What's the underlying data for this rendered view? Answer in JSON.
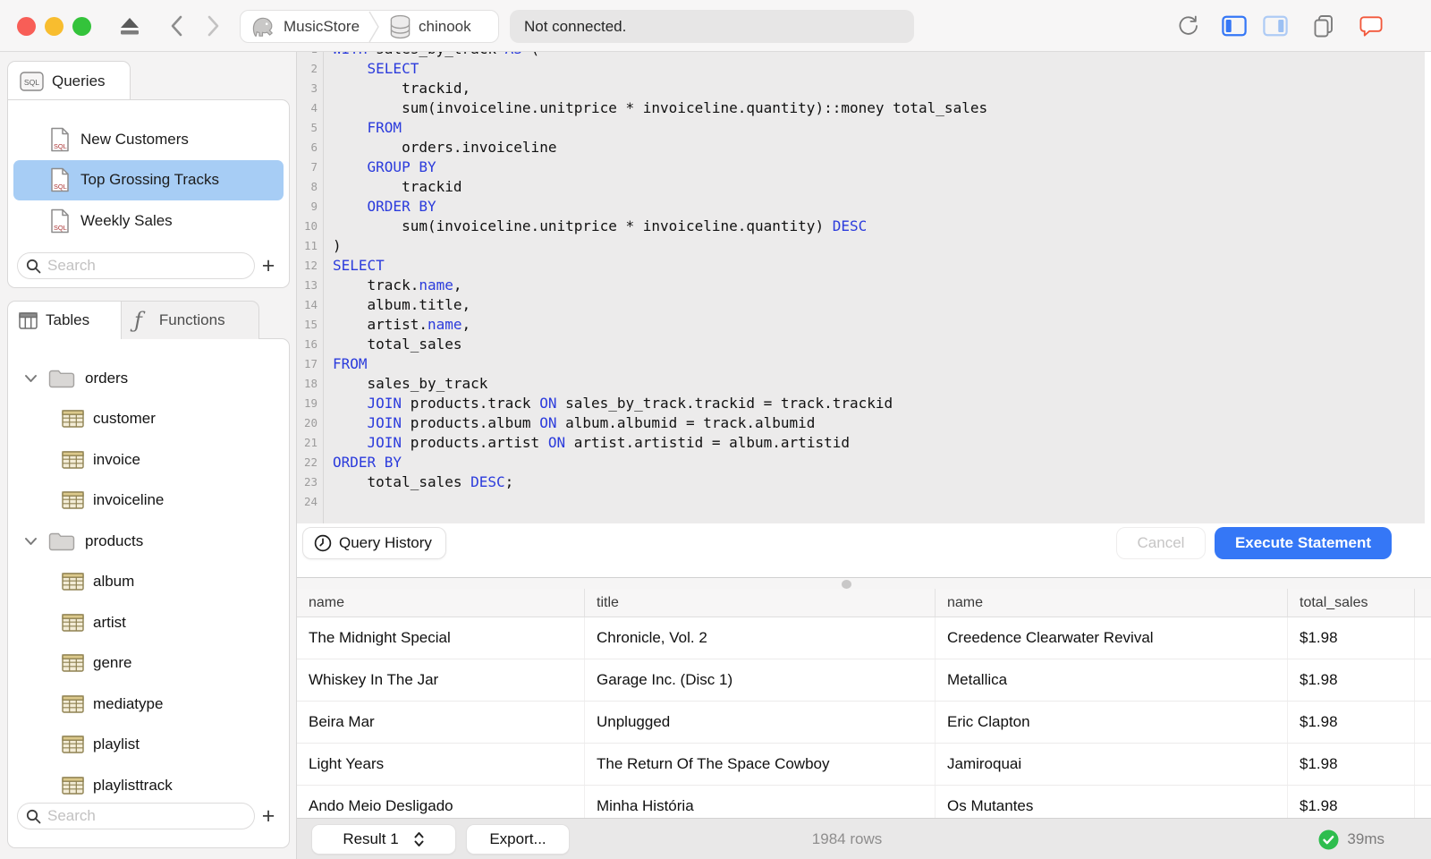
{
  "colors": {
    "accent": "#3577F6",
    "selection": "#A7CDF5",
    "keyword": "#2B3BDC",
    "success": "#2EBD4E",
    "chat": "#F2573A"
  },
  "titlebar": {
    "breadcrumb": [
      {
        "icon": "postgres-elephant",
        "label": "MusicStore"
      },
      {
        "icon": "database-cylinder",
        "label": "chinook"
      }
    ],
    "status": "Not connected."
  },
  "sidebar": {
    "queries": {
      "tab_label": "Queries",
      "items": [
        {
          "icon": "sql-file",
          "label": "New Customers",
          "selected": false
        },
        {
          "icon": "sql-file",
          "label": "Top Grossing Tracks",
          "selected": true
        },
        {
          "icon": "sql-file",
          "label": "Weekly Sales",
          "selected": false
        }
      ],
      "search_placeholder": "Search",
      "add_label": "+"
    },
    "tables": {
      "tabs": [
        "Tables",
        "Functions"
      ],
      "active_tab": "Tables",
      "tree": [
        {
          "type": "schema",
          "icon": "folder",
          "label": "orders"
        },
        {
          "type": "table",
          "icon": "table-grid",
          "label": "customer"
        },
        {
          "type": "table",
          "icon": "table-grid",
          "label": "invoice"
        },
        {
          "type": "table",
          "icon": "table-grid",
          "label": "invoiceline"
        },
        {
          "type": "schema",
          "icon": "folder",
          "label": "products"
        },
        {
          "type": "table",
          "icon": "table-grid",
          "label": "album"
        },
        {
          "type": "table",
          "icon": "table-grid",
          "label": "artist"
        },
        {
          "type": "table",
          "icon": "table-grid",
          "label": "genre"
        },
        {
          "type": "table",
          "icon": "table-grid",
          "label": "mediatype"
        },
        {
          "type": "table",
          "icon": "table-grid",
          "label": "playlist"
        },
        {
          "type": "table",
          "icon": "table-grid",
          "label": "playlisttrack"
        }
      ],
      "search_placeholder": "Search",
      "add_label": "+"
    }
  },
  "editor": {
    "lines": [
      [
        [
          "WITH",
          1
        ],
        [
          " sales_by_track ",
          0
        ],
        [
          "AS",
          1
        ],
        [
          " (",
          0
        ]
      ],
      [
        [
          "    ",
          0
        ],
        [
          "SELECT",
          1
        ]
      ],
      [
        [
          "        trackid,",
          0
        ]
      ],
      [
        [
          "        sum(invoiceline.unitprice * invoiceline.quantity)::money total_sales",
          0
        ]
      ],
      [
        [
          "    ",
          0
        ],
        [
          "FROM",
          1
        ]
      ],
      [
        [
          "        orders.invoiceline",
          0
        ]
      ],
      [
        [
          "    ",
          0
        ],
        [
          "GROUP BY",
          1
        ]
      ],
      [
        [
          "        trackid",
          0
        ]
      ],
      [
        [
          "    ",
          0
        ],
        [
          "ORDER BY",
          1
        ]
      ],
      [
        [
          "        sum(invoiceline.unitprice * invoiceline.quantity) ",
          0
        ],
        [
          "DESC",
          1
        ]
      ],
      [
        [
          ")",
          0
        ]
      ],
      [
        [
          "SELECT",
          1
        ]
      ],
      [
        [
          "    track.",
          0
        ],
        [
          "name",
          1
        ],
        [
          ",",
          0
        ]
      ],
      [
        [
          "    album.title,",
          0
        ]
      ],
      [
        [
          "    artist.",
          0
        ],
        [
          "name",
          1
        ],
        [
          ",",
          0
        ]
      ],
      [
        [
          "    total_sales",
          0
        ]
      ],
      [
        [
          "FROM",
          1
        ]
      ],
      [
        [
          "    sales_by_track",
          0
        ]
      ],
      [
        [
          "    ",
          0
        ],
        [
          "JOIN",
          1
        ],
        [
          " products.track ",
          0
        ],
        [
          "ON",
          1
        ],
        [
          " sales_by_track.trackid = track.trackid",
          0
        ]
      ],
      [
        [
          "    ",
          0
        ],
        [
          "JOIN",
          1
        ],
        [
          " products.album ",
          0
        ],
        [
          "ON",
          1
        ],
        [
          " album.albumid = track.albumid",
          0
        ]
      ],
      [
        [
          "    ",
          0
        ],
        [
          "JOIN",
          1
        ],
        [
          " products.artist ",
          0
        ],
        [
          "ON",
          1
        ],
        [
          " artist.artistid = album.artistid",
          0
        ]
      ],
      [
        [
          "ORDER BY",
          1
        ]
      ],
      [
        [
          "    total_sales ",
          0
        ],
        [
          "DESC",
          1
        ],
        [
          ";",
          0
        ]
      ],
      [
        [
          "",
          0
        ]
      ]
    ]
  },
  "actions": {
    "query_history": "Query History",
    "cancel": "Cancel",
    "execute": "Execute Statement"
  },
  "results": {
    "columns": [
      "name",
      "title",
      "name",
      "total_sales"
    ],
    "rows": [
      [
        "The Midnight Special",
        "Chronicle, Vol. 2",
        "Creedence Clearwater Revival",
        "$1.98"
      ],
      [
        "Whiskey In The Jar",
        "Garage Inc. (Disc 1)",
        "Metallica",
        "$1.98"
      ],
      [
        "Beira Mar",
        "Unplugged",
        "Eric Clapton",
        "$1.98"
      ],
      [
        "Light Years",
        "The Return Of The Space Cowboy",
        "Jamiroquai",
        "$1.98"
      ],
      [
        "Ando Meio Desligado",
        "Minha História",
        "Os Mutantes",
        "$1.98"
      ]
    ]
  },
  "statusbar": {
    "result_selector": "Result 1",
    "export_label": "Export...",
    "row_count": "1984 rows",
    "duration": "39ms"
  }
}
